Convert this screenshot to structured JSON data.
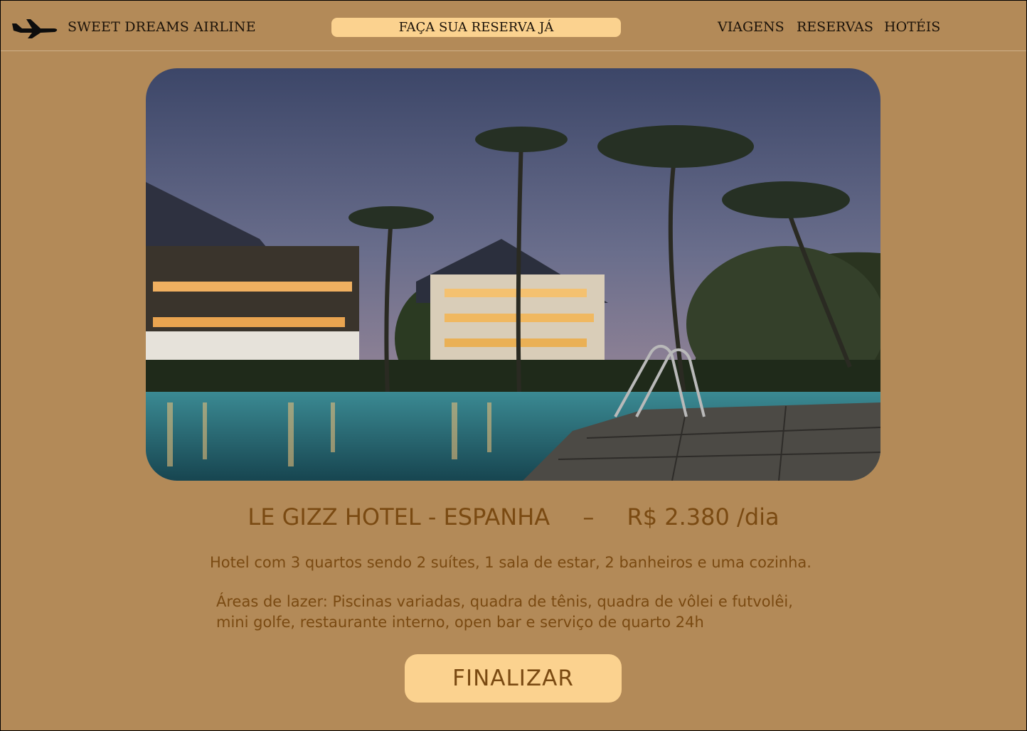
{
  "header": {
    "brand": "SWEET DREAMS AIRLINE",
    "cta_label": "FAÇA SUA RESERVA JÁ",
    "nav": [
      "VIAGENS",
      "RESERVAS",
      "HOTÉIS"
    ]
  },
  "hotel": {
    "name": "LE GIZZ HOTEL - ESPANHA",
    "separator": "–",
    "price": "R$ 2.380 /dia",
    "description": "Hotel com 3 quartos sendo 2 suítes, 1 sala de estar, 2 banheiros e uma cozinha.",
    "leisure": "Áreas de lazer: Piscinas variadas, quadra de tênis, quadra de vôlei e futvolêi, mini golfe, restaurante interno, open bar e serviço de quarto 24h"
  },
  "actions": {
    "finish_label": "FINALIZAR"
  },
  "colors": {
    "background": "#b38a58",
    "accent": "#fbd28f",
    "text_brown": "#7a4a12"
  },
  "icons": {
    "logo": "airplane-icon"
  }
}
